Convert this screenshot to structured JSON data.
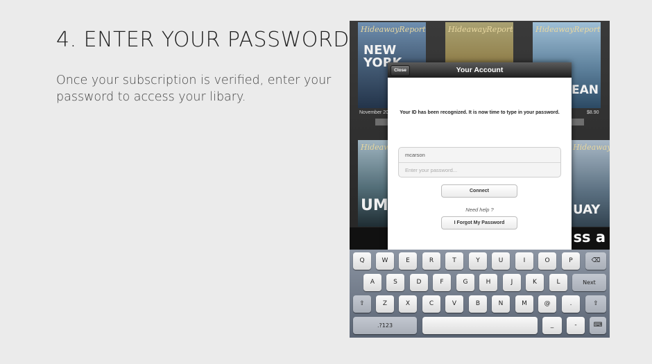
{
  "slide": {
    "heading": "4. ENTER YOUR PASSWORD",
    "description": "Once your subscription is verified, enter your password to access your libary."
  },
  "shelf": {
    "magazine_title": "HideawayReport",
    "cover_text_1": "NEW YORK",
    "cover_text_2": "EAN",
    "cover_text_3": "UME",
    "cover_text_4": "UAY",
    "left_date": "November 20",
    "right_price": "$8.90",
    "strip_text": "ss a"
  },
  "modal": {
    "title": "Your Account",
    "close_label": "Close",
    "message": "Your ID has been recognized. It is now time to type in your password.",
    "username_value": "mcarson",
    "password_placeholder": "Enter your password...",
    "connect_label": "Connect",
    "help_text": "Need help ?",
    "forgot_label": "I Forgot My Password"
  },
  "keyboard": {
    "row1": [
      "Q",
      "W",
      "E",
      "R",
      "T",
      "Y",
      "U",
      "I",
      "O",
      "P"
    ],
    "row2": [
      "A",
      "S",
      "D",
      "F",
      "G",
      "H",
      "J",
      "K",
      "L"
    ],
    "row3": [
      "Z",
      "X",
      "C",
      "V",
      "B",
      "N",
      "M",
      "@",
      "."
    ],
    "backspace": "⌫",
    "next": "Next",
    "shift": "⇧",
    "numbers": ".?123",
    "underscore": "_",
    "dash": "-",
    "hide_keyboard": "⌨"
  }
}
